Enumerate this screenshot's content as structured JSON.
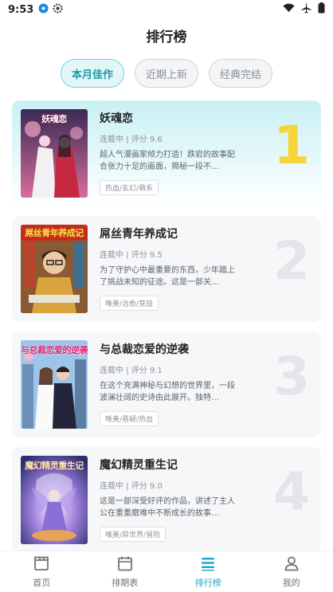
{
  "status": {
    "time": "9:53"
  },
  "header": {
    "title": "排行榜"
  },
  "tabs": [
    {
      "label": "本月佳作",
      "active": true
    },
    {
      "label": "近期上新",
      "active": false
    },
    {
      "label": "经典完结",
      "active": false
    }
  ],
  "ranking": [
    {
      "rank": "1",
      "cover_title": "妖魂恋",
      "title": "妖魂恋",
      "meta": "连载中 | 评分 9.6",
      "desc": "超人气漫画家倾力打造！跌宕的故事配合张力十足的画面，揭秘一段不…",
      "tags": "热血/玄幻/萌系"
    },
    {
      "rank": "2",
      "cover_title": "屌丝青年养成记",
      "title": "屌丝青年养成记",
      "meta": "连载中 | 评分 9.5",
      "desc": "为了守护心中最重要的东西，少年踏上了挑战未知的征途。这是一部关…",
      "tags": "唯美/治愈/竞技"
    },
    {
      "rank": "3",
      "cover_title": "与总裁恋爱的逆袭",
      "title": "与总裁恋爱的逆袭",
      "meta": "连载中 | 评分 9.1",
      "desc": "在这个充满神秘与幻想的世界里，一段波澜壮阔的史诗由此展开。独特…",
      "tags": "唯美/悬疑/热血"
    },
    {
      "rank": "4",
      "cover_title": "魔幻精灵重生记",
      "title": "魔幻精灵重生记",
      "meta": "连载中 | 评分 9.0",
      "desc": "这是一部深受好评的作品，讲述了主人公在重重磨难中不断成长的故事…",
      "tags": "唯美/异世界/冒险"
    }
  ],
  "bottom_nav": [
    {
      "label": "首页",
      "icon": "clapperboard-icon",
      "active": false
    },
    {
      "label": "排期表",
      "icon": "calendar-icon",
      "active": false
    },
    {
      "label": "排行榜",
      "icon": "list-icon",
      "active": true
    },
    {
      "label": "我的",
      "icon": "user-icon",
      "active": false
    }
  ],
  "colors": {
    "accent": "#1ea7c9",
    "tab_active_text": "#1b9aa8",
    "rank_gold": "#f6d43a"
  }
}
